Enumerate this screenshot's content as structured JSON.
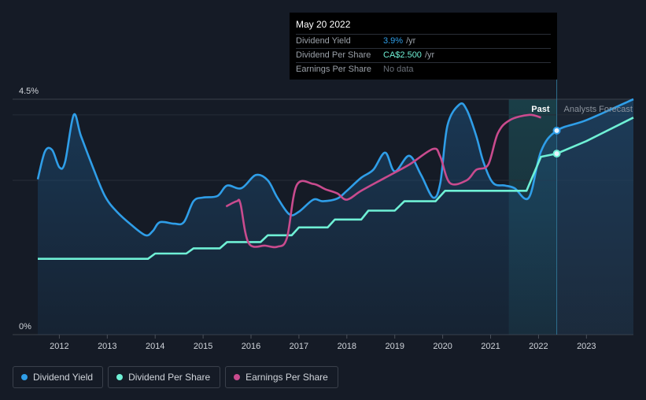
{
  "tooltip": {
    "date": "May 20 2022",
    "rows": [
      {
        "label": "Dividend Yield",
        "value": "3.9%",
        "unit": "/yr"
      },
      {
        "label": "Dividend Per Share",
        "value": "CA$2.500",
        "unit": "/yr"
      },
      {
        "label": "Earnings Per Share",
        "value": "No data",
        "unit": ""
      }
    ]
  },
  "legend": [
    {
      "label": "Dividend Yield",
      "color": "#2f9ee8"
    },
    {
      "label": "Dividend Per Share",
      "color": "#6ff0d5"
    },
    {
      "label": "Earnings Per Share",
      "color": "#c94b8e"
    }
  ],
  "chart_data": {
    "type": "line",
    "y_ticks": [
      "4.5%",
      "0%"
    ],
    "ylim": [
      0,
      4.5
    ],
    "x_ticks": [
      "2012",
      "2013",
      "2014",
      "2015",
      "2016",
      "2017",
      "2018",
      "2019",
      "2020",
      "2021",
      "2022",
      "2023"
    ],
    "xlim": [
      2011.55,
      2023.98
    ],
    "past_label": "Past",
    "forecast_label": "Analysts Forecast",
    "past_boundary": 2022.38,
    "highlight_start": 2021.38,
    "grid": true,
    "series": [
      {
        "name": "Dividend Yield",
        "color": "#2f9ee8",
        "points": [
          [
            2011.55,
            2.97
          ],
          [
            2011.7,
            3.5
          ],
          [
            2011.85,
            3.53
          ],
          [
            2012.0,
            3.2
          ],
          [
            2012.12,
            3.3
          ],
          [
            2012.3,
            4.2
          ],
          [
            2012.45,
            3.8
          ],
          [
            2012.7,
            3.2
          ],
          [
            2012.95,
            2.65
          ],
          [
            2013.2,
            2.35
          ],
          [
            2013.5,
            2.1
          ],
          [
            2013.8,
            1.9
          ],
          [
            2013.95,
            1.98
          ],
          [
            2014.1,
            2.15
          ],
          [
            2014.4,
            2.12
          ],
          [
            2014.6,
            2.15
          ],
          [
            2014.8,
            2.55
          ],
          [
            2015.0,
            2.62
          ],
          [
            2015.3,
            2.65
          ],
          [
            2015.5,
            2.85
          ],
          [
            2015.8,
            2.8
          ],
          [
            2016.1,
            3.05
          ],
          [
            2016.35,
            2.95
          ],
          [
            2016.55,
            2.62
          ],
          [
            2016.8,
            2.3
          ],
          [
            2017.0,
            2.35
          ],
          [
            2017.3,
            2.58
          ],
          [
            2017.5,
            2.55
          ],
          [
            2017.8,
            2.6
          ],
          [
            2018.0,
            2.75
          ],
          [
            2018.3,
            3.0
          ],
          [
            2018.55,
            3.15
          ],
          [
            2018.8,
            3.48
          ],
          [
            2019.0,
            3.12
          ],
          [
            2019.3,
            3.42
          ],
          [
            2019.55,
            3.05
          ],
          [
            2019.8,
            2.62
          ],
          [
            2019.95,
            2.9
          ],
          [
            2020.1,
            4.0
          ],
          [
            2020.35,
            4.4
          ],
          [
            2020.5,
            4.3
          ],
          [
            2020.7,
            3.8
          ],
          [
            2020.85,
            3.3
          ],
          [
            2021.05,
            2.9
          ],
          [
            2021.3,
            2.85
          ],
          [
            2021.5,
            2.8
          ],
          [
            2021.8,
            2.62
          ],
          [
            2022.05,
            3.5
          ],
          [
            2022.38,
            3.9
          ],
          [
            2023.0,
            4.1
          ],
          [
            2023.98,
            4.5
          ]
        ]
      },
      {
        "name": "Dividend Per Share",
        "color": "#6ff0d5",
        "points": [
          [
            2011.55,
            1.45
          ],
          [
            2013.85,
            1.45
          ],
          [
            2014.0,
            1.55
          ],
          [
            2014.65,
            1.55
          ],
          [
            2014.8,
            1.65
          ],
          [
            2015.35,
            1.65
          ],
          [
            2015.5,
            1.77
          ],
          [
            2016.2,
            1.77
          ],
          [
            2016.35,
            1.9
          ],
          [
            2016.85,
            1.9
          ],
          [
            2017.0,
            2.05
          ],
          [
            2017.6,
            2.05
          ],
          [
            2017.75,
            2.2
          ],
          [
            2018.3,
            2.2
          ],
          [
            2018.45,
            2.37
          ],
          [
            2019.0,
            2.37
          ],
          [
            2019.2,
            2.55
          ],
          [
            2019.85,
            2.55
          ],
          [
            2020.05,
            2.75
          ],
          [
            2021.75,
            2.75
          ],
          [
            2022.05,
            3.4
          ],
          [
            2022.38,
            3.46
          ],
          [
            2023.0,
            3.7
          ],
          [
            2023.98,
            4.15
          ]
        ]
      },
      {
        "name": "Earnings Per Share",
        "color": "#c94b8e",
        "points": [
          [
            2015.48,
            2.45
          ],
          [
            2015.7,
            2.55
          ],
          [
            2015.78,
            2.5
          ],
          [
            2015.95,
            1.75
          ],
          [
            2016.3,
            1.7
          ],
          [
            2016.55,
            1.68
          ],
          [
            2016.75,
            1.85
          ],
          [
            2016.95,
            2.85
          ],
          [
            2017.3,
            2.88
          ],
          [
            2017.55,
            2.78
          ],
          [
            2017.8,
            2.7
          ],
          [
            2018.0,
            2.58
          ],
          [
            2018.3,
            2.75
          ],
          [
            2018.8,
            3.0
          ],
          [
            2019.3,
            3.25
          ],
          [
            2019.8,
            3.55
          ],
          [
            2019.95,
            3.4
          ],
          [
            2020.15,
            2.9
          ],
          [
            2020.5,
            2.95
          ],
          [
            2020.7,
            3.15
          ],
          [
            2020.95,
            3.25
          ],
          [
            2021.15,
            3.85
          ],
          [
            2021.4,
            4.1
          ],
          [
            2021.8,
            4.2
          ],
          [
            2022.05,
            4.15
          ]
        ]
      }
    ],
    "markers": [
      {
        "series": "Dividend Yield",
        "x": 2022.38,
        "y": 3.9
      },
      {
        "series": "Dividend Per Share",
        "x": 2022.38,
        "y": 3.46
      }
    ]
  }
}
